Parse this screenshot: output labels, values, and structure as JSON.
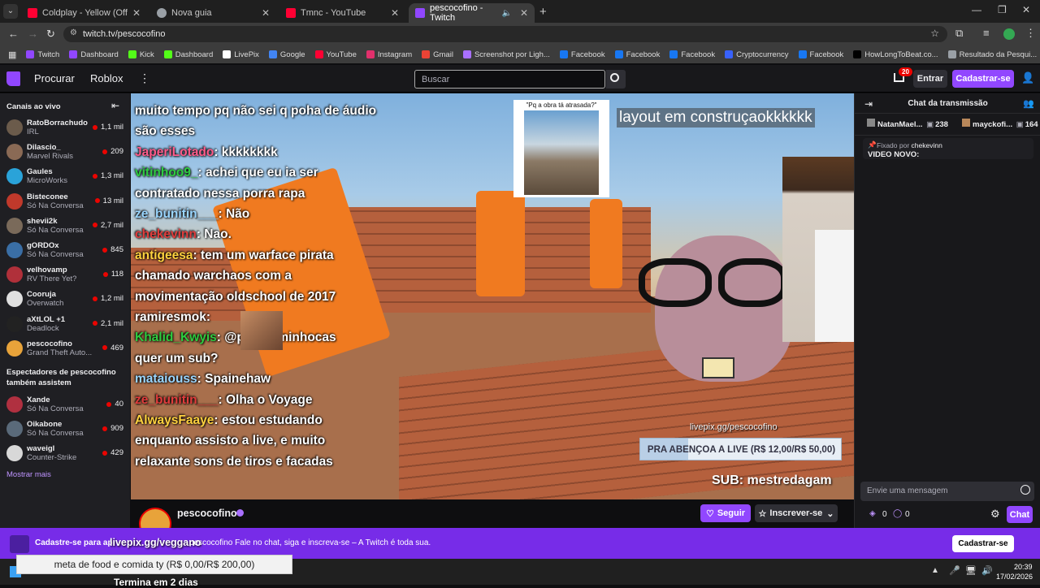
{
  "browser": {
    "tabs": [
      {
        "title": "Coldplay - Yellow (Official Video)",
        "color": "#ff0033"
      },
      {
        "title": "Nova guia",
        "color": "#9aa0a6"
      },
      {
        "title": "Tmnc - YouTube",
        "color": "#ff0033"
      },
      {
        "title": "pescocofino - Twitch",
        "color": "#9147ff"
      }
    ],
    "url": "twitch.tv/pescocofino",
    "bookmarks": [
      {
        "label": "Twitch",
        "color": "#9147ff"
      },
      {
        "label": "Dashboard",
        "color": "#9147ff"
      },
      {
        "label": "Kick",
        "color": "#53fc18"
      },
      {
        "label": "Dashboard",
        "color": "#53fc18"
      },
      {
        "label": "LivePix",
        "color": "#ffffff"
      },
      {
        "label": "Google",
        "color": "#4285f4"
      },
      {
        "label": "YouTube",
        "color": "#ff0033"
      },
      {
        "label": "Instagram",
        "color": "#e1306c"
      },
      {
        "label": "Gmail",
        "color": "#ea4335"
      },
      {
        "label": "Screenshot por Ligh...",
        "color": "#a970ff"
      },
      {
        "label": "Facebook",
        "color": "#1877f2"
      },
      {
        "label": "Facebook",
        "color": "#1877f2"
      },
      {
        "label": "Facebook",
        "color": "#1877f2"
      },
      {
        "label": "Cryptocurrency",
        "color": "#3861fb"
      },
      {
        "label": "Facebook",
        "color": "#1877f2"
      },
      {
        "label": "HowLongToBeat.co...",
        "color": "#000000"
      },
      {
        "label": "Resultado da Pesqui...",
        "color": "#9aa0a6"
      }
    ]
  },
  "nav": {
    "browse": "Procurar",
    "roblox": "Roblox",
    "search_placeholder": "Buscar",
    "notif_count": "20",
    "login": "Entrar",
    "signup": "Cadastrar-se"
  },
  "sidebar": {
    "live_header": "Canais ao vivo",
    "channels": [
      {
        "name": "RatoBorrachudo",
        "game": "IRL",
        "viewers": "1,1 mil",
        "color": "#6b5b4b"
      },
      {
        "name": "Dilascio_",
        "game": "Marvel Rivals",
        "viewers": "209",
        "color": "#8a6a55"
      },
      {
        "name": "Gaules",
        "game": "MicroWorks",
        "viewers": "1,3 mil",
        "color": "#2aa3d9"
      },
      {
        "name": "Bisteconee",
        "game": "Só Na Conversa",
        "viewers": "13 mil",
        "color": "#c0392b"
      },
      {
        "name": "shevii2k",
        "game": "Só Na Conversa",
        "viewers": "2,7 mil",
        "color": "#7a6a5a"
      },
      {
        "name": "gORDOx",
        "game": "Só Na Conversa",
        "viewers": "845",
        "color": "#3a6ea5"
      },
      {
        "name": "velhovamp",
        "game": "RV There Yet?",
        "viewers": "118",
        "color": "#b0303a"
      },
      {
        "name": "Cooruja",
        "game": "Overwatch",
        "viewers": "1,2 mil",
        "color": "#e0e0e0"
      },
      {
        "name": "aXtLOL +1",
        "game": "Deadlock",
        "viewers": "2,1 mil",
        "color": "#222222"
      },
      {
        "name": "pescocofino",
        "game": "Grand Theft Auto...",
        "viewers": "469",
        "color": "#e8a33a"
      }
    ],
    "watch_header": "Espectadores de pescocofino também assistem",
    "also_watch": [
      {
        "name": "Xande",
        "game": "Só Na Conversa",
        "viewers": "40",
        "color": "#b03040"
      },
      {
        "name": "Oikabone",
        "game": "Só Na Conversa",
        "viewers": "909",
        "color": "#5a6a7a"
      },
      {
        "name": "waveigl",
        "game": "Counter-Strike",
        "viewers": "429",
        "color": "#d8d8d8"
      }
    ],
    "show_more": "Mostrar mais"
  },
  "video": {
    "overlay_chat": [
      {
        "user": "",
        "text": "muito tempo pq não sei q poha de áudio"
      },
      {
        "user": "",
        "text": "são esses"
      },
      {
        "user": "JaperiLotado",
        "text": ": kkkkkkkk"
      },
      {
        "user": "vitinhoo9_",
        "text": ": achei que eu ia ser"
      },
      {
        "user": "",
        "text": "contratado nessa porra rapa"
      },
      {
        "user": "ze_bunitin___",
        "text": ": Não"
      },
      {
        "user": "chekevinn",
        "text": ": Nao."
      },
      {
        "user": "antigeesa",
        "text": ": tem um warface pirata"
      },
      {
        "user": "",
        "text": "chamado warchaos com a"
      },
      {
        "user": "",
        "text": "movimentação oldschool de 2017"
      },
      {
        "user": "ramiresmok",
        "text": ":"
      },
      {
        "user": "Khalid_Kwyis",
        "text": ": @paulo_minhocas"
      },
      {
        "user": "",
        "text": "quer um sub?"
      },
      {
        "user": "mataiouss",
        "text": ": Spainehaw"
      },
      {
        "user": "ze_bunitin___",
        "text": ": Olha o Voyage"
      },
      {
        "user": "AlwaysFaaye",
        "text": ": estou estudando"
      },
      {
        "user": "",
        "text": "enquanto assisto a live, e muito"
      },
      {
        "user": "",
        "text": "relaxante sons de tiros e facadas"
      }
    ],
    "meme_caption": "\"Pq a obra tá atrasada?\"",
    "layout_text": "layout em construçaokkkkkk",
    "livepix_url": "livepix.gg/pescocofino",
    "goal_text": "PRA ABENÇOA A LIVE (R$ 12,00/R$ 50,00)",
    "goal_progress": 0.24,
    "sub_text": "SUB: mestredagam"
  },
  "channel": {
    "name": "pescocofino",
    "follow": "Seguir",
    "subscribe": "Inscrever-se"
  },
  "chat": {
    "title": "Chat da transmissão",
    "top_users": [
      {
        "name": "NatanMael...",
        "count": "238"
      },
      {
        "name": "mayckofi...",
        "count": "164"
      }
    ],
    "pinned_by": "Fixado por",
    "pinned_user": "chekevinn",
    "pinned_text": "VIDEO NOVO:",
    "input_placeholder": "Envie uma mensagem",
    "points": "0",
    "bits": "0",
    "chat_button": "Chat"
  },
  "banner": {
    "text_pre": "Cadastre-se para ap",
    "overlay_name": "livepix.gg/veggano",
    "text_post": "pescocofino  Fale no chat, siga e inscreva-se – A Twitch é toda sua.",
    "signup": "Cadastrar-se"
  },
  "bottom_overlay": {
    "goal": "meta de food e comida ty (R$ 0,00/R$ 200,00)",
    "ends": "Termina em 2 dias"
  },
  "taskbar": {
    "time": "20:39",
    "date": "17/02/2026"
  }
}
